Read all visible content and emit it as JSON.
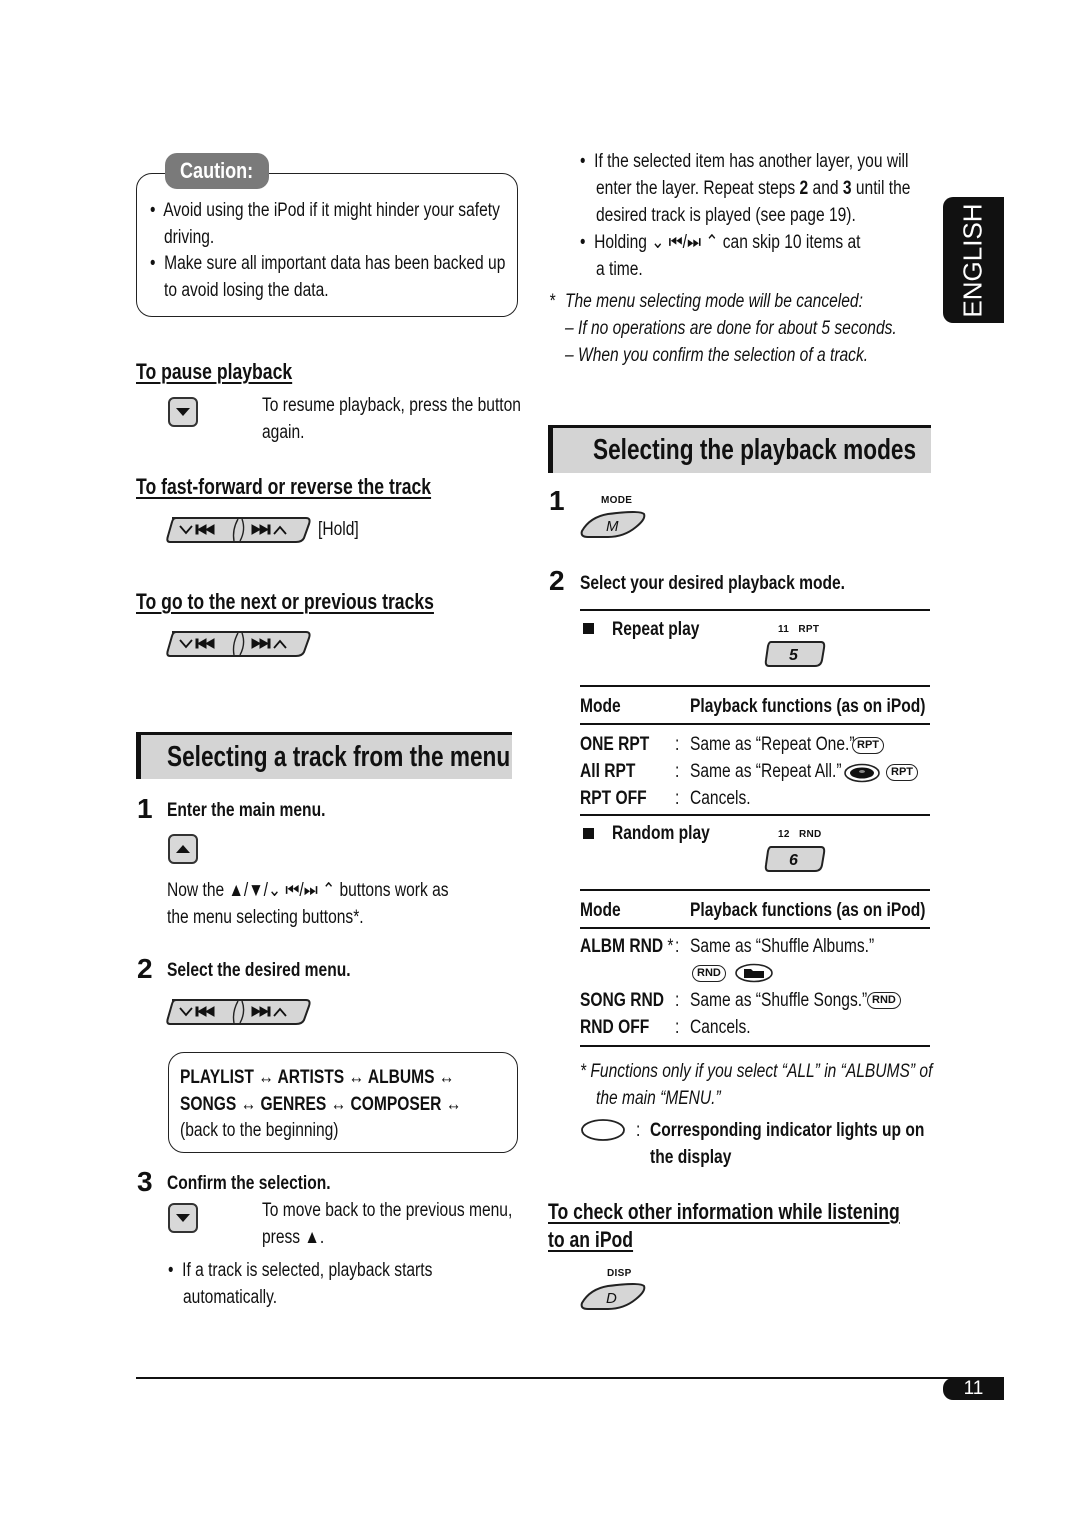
{
  "caution": {
    "title": "Caution:",
    "items": [
      "Avoid using the iPod if it might hinder your safety",
      "driving.",
      "Make sure all important data has been backed up",
      "to avoid losing the data."
    ]
  },
  "pause": {
    "heading": "To pause playback",
    "text1": "To resume playback, press the button",
    "text2": "again."
  },
  "ffrev": {
    "heading": "To fast-forward or reverse the track",
    "hold_label": "[Hold]"
  },
  "nextprev": {
    "heading": "To go to the next or previous tracks"
  },
  "menu_section": {
    "title": "Selecting a track from the menu",
    "step1": {
      "num": "1",
      "label": "Enter the main menu.",
      "desc1": "Now the ▲/▼/⌄ ⏮/⏭ ⌃ buttons work as",
      "desc2": "the menu selecting buttons*."
    },
    "step2": {
      "num": "2",
      "label": "Select the desired menu.",
      "flow_line1": "PLAYLIST ↔ ARTISTS ↔ ALBUMS ↔",
      "flow_line2": "SONGS ↔ GENRES ↔ COMPOSER ↔",
      "flow_line3": "(back to the beginning)"
    },
    "step3": {
      "num": "3",
      "label": "Confirm the selection.",
      "desc1": "To move back to the previous menu,",
      "desc2": "press ▲.",
      "bullet1": "If a track is selected, playback starts",
      "bullet2": "automatically."
    }
  },
  "right_top": {
    "bullet1_l1": "If the selected item has another layer, you will",
    "bullet1_l2a": "enter the layer. Repeat steps ",
    "bullet1_l2b": "2",
    "bullet1_l2c": " and ",
    "bullet1_l2d": "3",
    "bullet1_l2e": " until the",
    "bullet1_l3": "desired track is played (see page 19).",
    "bullet2_l1": "Holding ⌄ ⏮/⏭ ⌃ can skip 10 items at",
    "bullet2_l2": "a time.",
    "note_star": "*",
    "note_l1": "The menu selecting mode will be canceled:",
    "note_l2": "– If no operations are done for about 5 seconds.",
    "note_l3": "– When you confirm the selection of a track."
  },
  "language_tab": "ENGLISH",
  "modes_section": {
    "title": "Selecting the playback modes",
    "step1": {
      "num": "1",
      "button_caption": "MODE",
      "button_glyph": "M"
    },
    "step2": {
      "num": "2",
      "label": "Select your desired playback mode."
    },
    "repeat": {
      "label": "Repeat play",
      "button_caption": "11   RPT",
      "button_glyph": "5",
      "col_mode": "Mode",
      "col_func": "Playback functions (as on iPod)",
      "rows": [
        {
          "mode": "ONE RPT",
          "sep": ":",
          "func": "Same as “Repeat One.”",
          "ind": "RPT"
        },
        {
          "mode": "All RPT",
          "sep": ":",
          "func": "Same as “Repeat All.”",
          "ind": "RPT"
        },
        {
          "mode": "RPT OFF",
          "sep": ":",
          "func": "Cancels."
        }
      ]
    },
    "random": {
      "label": "Random play",
      "button_caption": "12   RND",
      "button_glyph": "6",
      "col_mode": "Mode",
      "col_func": "Playback functions (as on iPod)",
      "rows": [
        {
          "mode": "ALBM RND",
          "star": "*",
          "sep": ":",
          "func": "Same as “Shuffle Albums.”",
          "ind": "RND"
        },
        {
          "mode": "SONG RND",
          "sep": ":",
          "func": "Same as “Shuffle Songs.”",
          "ind": "RND"
        },
        {
          "mode": "RND OFF",
          "sep": ":",
          "func": "Cancels."
        }
      ]
    },
    "footnote_l1": "* Functions only if you select “ALL” in “ALBUMS” of",
    "footnote_l2": "the main “MENU.”",
    "indicator_sep": ":",
    "indicator_l1": "Corresponding indicator lights up on",
    "indicator_l2": "the display"
  },
  "check_info": {
    "heading_l1": "To check other information while listening",
    "heading_l2": "to an iPod",
    "button_caption": "DISP",
    "button_glyph": "D"
  },
  "page_number": "11"
}
